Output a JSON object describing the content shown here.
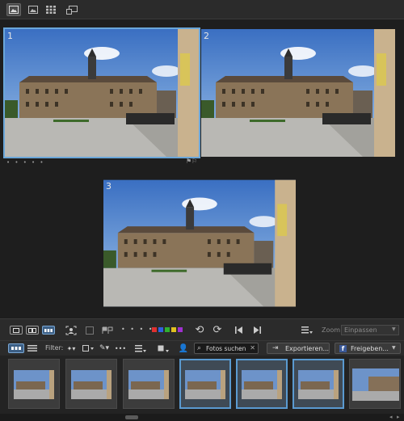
{
  "toolbar_top": {
    "buttons": [
      "single-view-icon",
      "grid-view-icon",
      "compare-view-icon",
      "fullscreen-icon"
    ]
  },
  "compare": {
    "photos": [
      {
        "number": "1",
        "selected": true
      },
      {
        "number": "2",
        "selected": false
      },
      {
        "number": "3",
        "selected": false
      }
    ],
    "rating_dots": "• • • • •"
  },
  "bar1": {
    "rating_dots": "• • • • •",
    "color_labels": [
      "#e03030",
      "#3060e0",
      "#30b030",
      "#e0c020",
      "#a030d0"
    ],
    "zoom_label": "Zoom:",
    "zoom_value": "Einpassen",
    "dropdown_icon": "sort-icon"
  },
  "bar2": {
    "filter_label": "Filter:",
    "search_text": "Fotos suchen",
    "export_label": "Exportieren...",
    "share_label": "Freigeben..."
  },
  "colors": {
    "accent": "#5a9ad0",
    "background": "#1e1e1e",
    "toolbar": "#2b2b2b"
  }
}
